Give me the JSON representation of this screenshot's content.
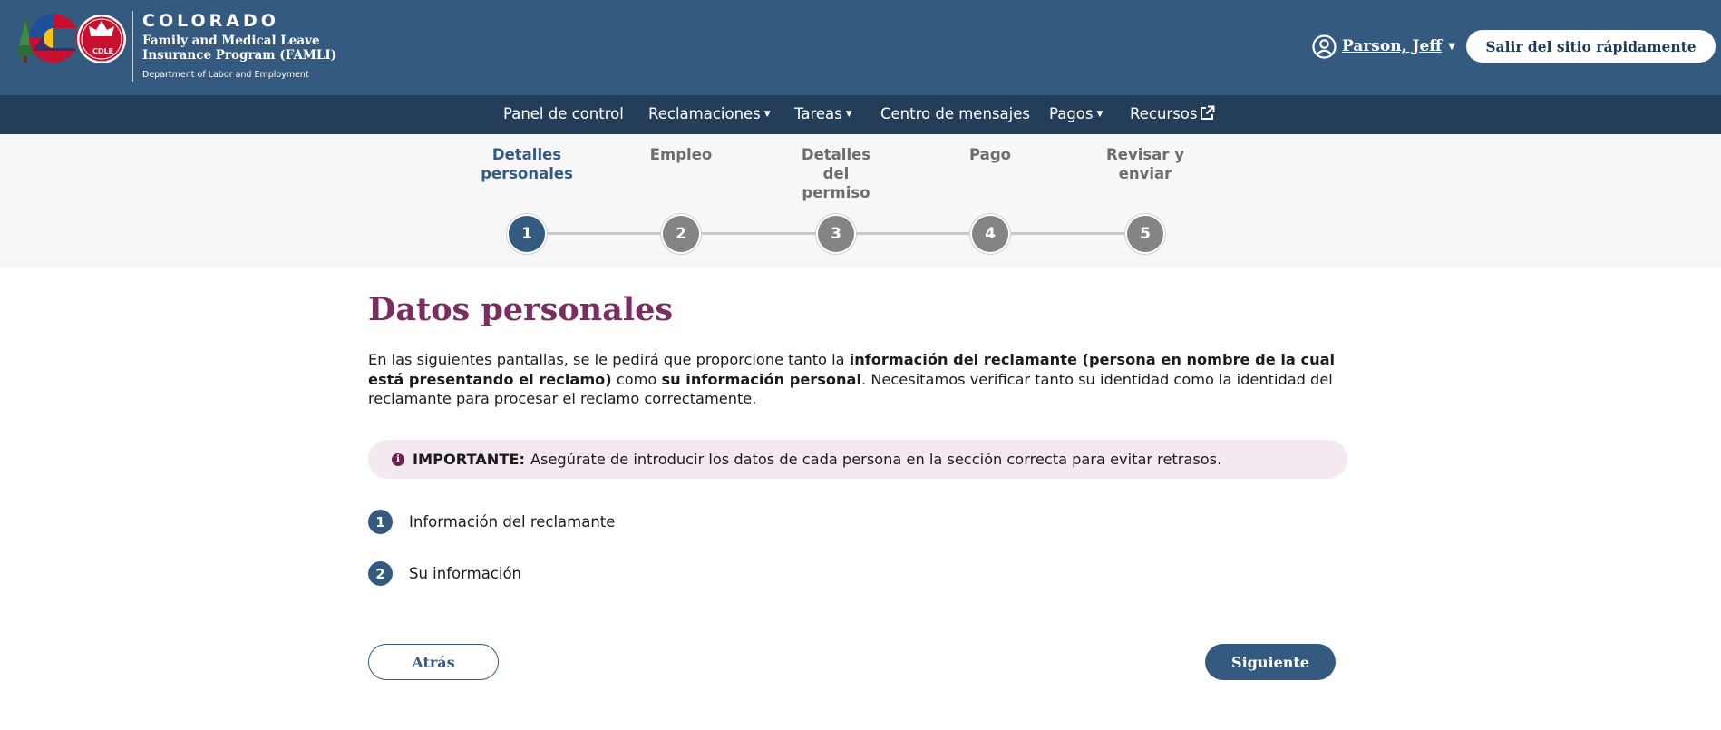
{
  "header": {
    "brand_state": "COLORADO",
    "program_line1": "Family and Medical Leave",
    "program_line2": "Insurance Program (FAMLI)",
    "department": "Department of Labor and Employment",
    "logo_badge_text": "CDLE",
    "user_name": "Parson, Jeff",
    "quick_exit_label": "Salir del sitio rápidamente"
  },
  "nav": {
    "items": [
      {
        "label": "Panel de control",
        "dropdown": false
      },
      {
        "label": "Reclamaciones",
        "dropdown": true
      },
      {
        "label": "Tareas",
        "dropdown": true
      },
      {
        "label": "Centro de mensajes",
        "dropdown": false
      },
      {
        "label": "Pagos",
        "dropdown": true
      },
      {
        "label": "Recursos",
        "external": true
      }
    ]
  },
  "stepper": {
    "current_step": 1,
    "steps": [
      {
        "number": "1",
        "label": "Detalles personales"
      },
      {
        "number": "2",
        "label": "Empleo"
      },
      {
        "number": "3",
        "label": "Detalles del permiso"
      },
      {
        "number": "4",
        "label": "Pago"
      },
      {
        "number": "5",
        "label": "Revisar y enviar"
      }
    ]
  },
  "main": {
    "title": "Datos personales",
    "intro_part1": "En las siguientes pantallas, se le pedirá que proporcione tanto la ",
    "intro_bold1": "información del reclamante (persona en nombre de la cual está presentando el reclamo)",
    "intro_part2": " como ",
    "intro_bold2": "su información personal",
    "intro_part3": ". Necesitamos verificar tanto su identidad como la identidad del reclamante para procesar el reclamo correctamente.",
    "alert_label": "IMPORTANTE:",
    "alert_text": "Asegúrate de introducir los datos de cada persona en la sección correcta para evitar retrasos.",
    "list": [
      {
        "number": "1",
        "label": "Información del reclamante"
      },
      {
        "number": "2",
        "label": "Su información"
      }
    ],
    "back_label": "Atrás",
    "next_label": "Siguiente"
  },
  "colors": {
    "header_bg": "#355a7f",
    "nav_bg": "#243e5a",
    "title_color": "#7b2d62",
    "alert_bg": "#f4e9f0",
    "active_step": "#355a7f",
    "inactive_step": "#848484"
  }
}
